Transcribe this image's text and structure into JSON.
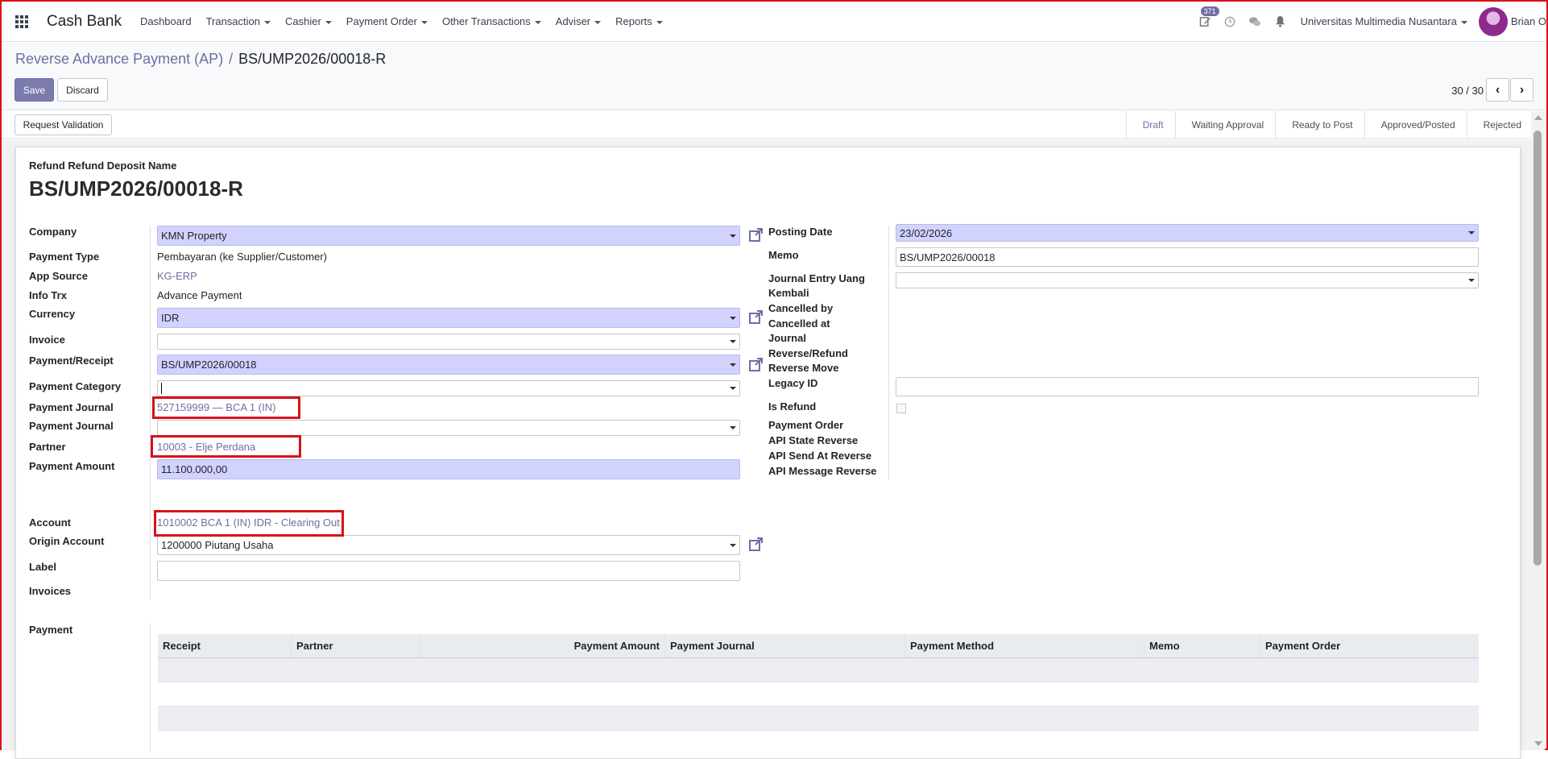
{
  "navbar": {
    "app_name": "Cash Bank",
    "menu": [
      "Dashboard",
      "Transaction",
      "Cashier",
      "Payment Order",
      "Other Transactions",
      "Adviser",
      "Reports"
    ],
    "activity_count": "371",
    "company": "Universitas Multimedia Nusantara",
    "user": "Brian O"
  },
  "breadcrumb": {
    "parent": "Reverse Advance Payment (AP)",
    "separator": "/",
    "current": "BS/UMP2026/00018-R"
  },
  "buttons": {
    "save": "Save",
    "discard": "Discard",
    "request_validation": "Request Validation"
  },
  "pager": {
    "value": "30 / 30"
  },
  "status_steps": [
    "Draft",
    "Waiting Approval",
    "Ready to Post",
    "Approved/Posted",
    "Rejected"
  ],
  "status_active": "Draft",
  "form": {
    "subtitle": "Refund Refund Deposit Name",
    "title": "BS/UMP2026/00018-R",
    "left": {
      "company_label": "Company",
      "company_value": "KMN Property",
      "payment_type_label": "Payment Type",
      "payment_type_value": "Pembayaran (ke Supplier/Customer)",
      "app_source_label": "App Source",
      "app_source_value": "KG-ERP",
      "info_trx_label": "Info Trx",
      "info_trx_value": "Advance Payment",
      "currency_label": "Currency",
      "currency_value": "IDR",
      "invoice_label": "Invoice",
      "invoice_value": "",
      "payment_receipt_label": "Payment/Receipt",
      "payment_receipt_value": "BS/UMP2026/00018",
      "payment_category_label": "Payment Category",
      "payment_category_value": "",
      "payment_journal_label": "Payment Journal",
      "payment_journal_value": "527159999 — BCA 1 (IN)",
      "payment_journal2_label": "Payment Journal",
      "payment_journal2_value": "",
      "partner_label": "Partner",
      "partner_value": "10003 - Elje Perdana",
      "payment_amount_label": "Payment Amount",
      "payment_amount_value": "11.100.000,00",
      "account_label": "Account",
      "account_value": "1010002 BCA 1 (IN) IDR - Clearing Out",
      "origin_account_label": "Origin Account",
      "origin_account_value": "1200000 Piutang Usaha",
      "label_label": "Label",
      "label_value": "",
      "invoices_label": "Invoices",
      "payment_label": "Payment"
    },
    "right": {
      "posting_date_label": "Posting Date",
      "posting_date_value": "23/02/2026",
      "memo_label": "Memo",
      "memo_value": "BS/UMP2026/00018",
      "je_uang_kembali_label_1": "Journal Entry Uang",
      "je_uang_kembali_label_2": "Kembali",
      "je_uang_kembali_value": "",
      "cancelled_by_label": "Cancelled by",
      "cancelled_at_label": "Cancelled at",
      "journal_reverse_label_1": "Journal",
      "journal_reverse_label_2": "Reverse/Refund",
      "reverse_move_label": "Reverse Move",
      "legacy_id_label": "Legacy ID",
      "legacy_id_value": "",
      "is_refund_label": "Is Refund",
      "payment_order_label": "Payment Order",
      "api_state_reverse_label": "API State Reverse",
      "api_send_at_reverse_label": "API Send At Reverse",
      "api_message_reverse_label": "API Message Reverse"
    }
  },
  "payment_table": {
    "columns": [
      "Receipt",
      "Partner",
      "Payment Amount",
      "Payment Journal",
      "Payment Method",
      "Memo",
      "Payment Order"
    ],
    "rows": []
  },
  "colors": {
    "accent": "#6f6ea3",
    "required_bg": "#d2d2ff",
    "highlight": "#d8121a"
  }
}
